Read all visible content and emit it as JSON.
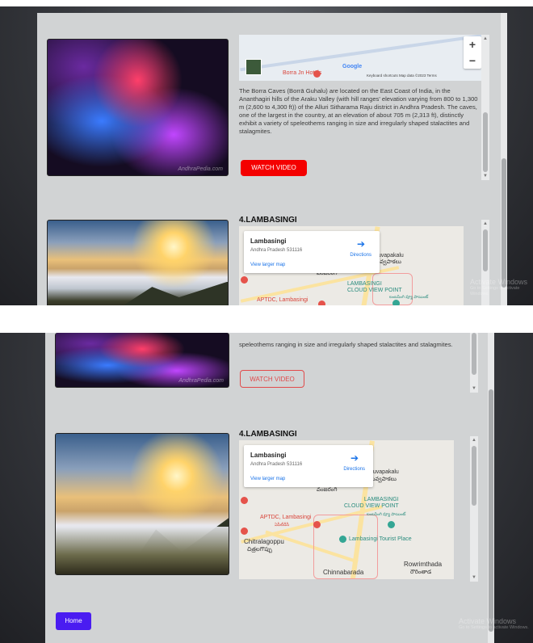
{
  "borra": {
    "description": "The Borra Caves (Borrā Guhalu) are located on the East Coast of India, in the Ananthagiri hills of the Araku Valley (with hill ranges' elevation varying from 800 to 1,300 m (2,600 to 4,300 ft)) of the Alluri Sitharama Raju district in Andhra Pradesh. The caves, one of the largest in the country, at an elevation of about 705 m (2,313 ft), distinctly exhibit a variety of speleothems ranging in size and irregularly shaped stalactites and stalagmites.",
    "description_tail": "speleothems ranging in size and irregularly shaped stalactites and stalagmites.",
    "watch_video_label": "WATCH VIDEO",
    "map": {
      "place_label": "Borra Jn Hotels",
      "google_logo": "Google",
      "zoom_in": "+",
      "zoom_out": "−",
      "attribution": "Keyboard shortcuts   Map data ©2023   Terms"
    },
    "photo_watermark": "AndhraPedia.com"
  },
  "lambasingi": {
    "heading": "4.LAMBASINGI",
    "map": {
      "card_title": "Lambasingi",
      "card_subtitle": "Andhra Pradesh 531116",
      "directions_label": "Directions",
      "view_larger_map": "View larger map",
      "labels": {
        "guvvapakalu": "guvapakalu",
        "guvvapakalu_te": "గువ్వపాకలు",
        "village_te": "వంజరంగి",
        "cloud_view_point": "LAMBASINGI\nCLOUD VIEW POINT",
        "cloud_view_point_te": "లంబసింగి వ్యూ పాయింట్",
        "aptdc": "APTDC, Lambasingi",
        "aptdc_te": "ఏపీటీడీసీ",
        "chitralagoppu": "Chitralagoppu",
        "chitralagoppu_te": "చిత్రలగొప్పు",
        "tourist_place": "Lambasingi Tourist Place",
        "rowrimthada": "Rowrimthada",
        "rowrimthada_te": "రౌరింతాడ",
        "chinnabarada": "Chinnabarada"
      }
    }
  },
  "home_label": "Home",
  "activate_windows": {
    "title": "Activate Windows",
    "subtitle": "Go to Settings to activate Windows."
  }
}
